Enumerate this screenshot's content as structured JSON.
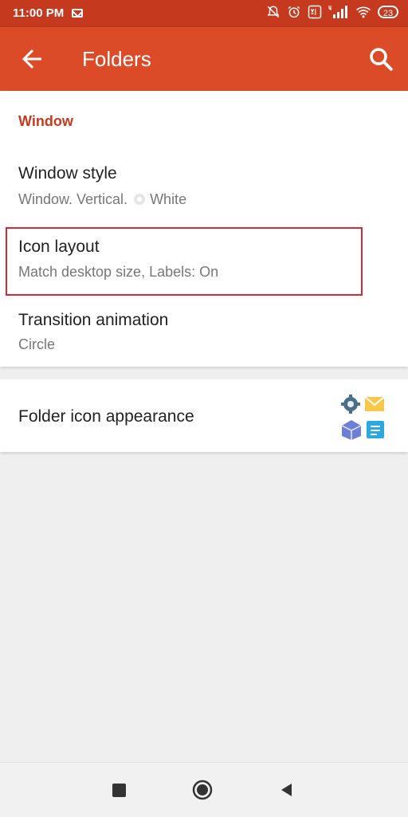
{
  "status_bar": {
    "time": "11:00 PM",
    "battery": "23",
    "icons": [
      "mail-icon",
      "mute-icon",
      "alarm-icon",
      "volte-icon",
      "signal-4g-icon",
      "wifi-icon",
      "battery-icon"
    ]
  },
  "app_bar": {
    "title": "Folders",
    "back_icon": "arrow-back-icon",
    "search_icon": "search-icon",
    "color": "#dc4b27"
  },
  "section": {
    "title": "Window"
  },
  "preferences": [
    {
      "title": "Window style",
      "summary_a": "Window.  Vertical.",
      "summary_b": "White"
    },
    {
      "title": "Icon layout",
      "summary": "Match desktop size, Labels: On"
    },
    {
      "title": "Transition animation",
      "summary": "Circle"
    }
  ],
  "folder_appearance": {
    "title": "Folder icon appearance",
    "icon": "folder-preview-icon"
  },
  "nav_bar": {
    "icons": [
      "recents-icon",
      "home-icon",
      "back-icon"
    ]
  },
  "colors": {
    "status_bar": "#c5391e",
    "accent": "#dc4b27",
    "section_title": "#c5391e",
    "highlight_border": "#d7283a"
  }
}
